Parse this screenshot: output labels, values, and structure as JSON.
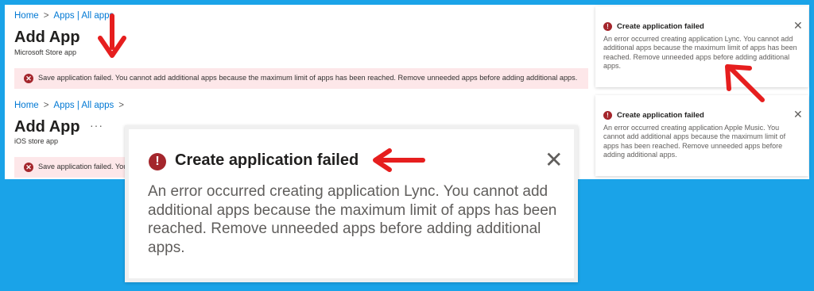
{
  "colors": {
    "background": "#1aa3e8",
    "error_red": "#a4262c",
    "error_bar": "#fde7e9",
    "link_blue": "#0078d4",
    "annotation_arrow": "#e61e1e"
  },
  "top_section": {
    "breadcrumb": {
      "home": "Home",
      "separator": ">",
      "apps": "Apps | All apps"
    },
    "title": "Add App",
    "subtitle": "Microsoft Store app",
    "error_message": "Save application failed. You cannot add additional apps because the maximum limit of apps has been reached. Remove unneeded apps before adding additional apps."
  },
  "bottom_section": {
    "breadcrumb": {
      "home": "Home",
      "separator": ">",
      "apps": "Apps | All apps",
      "trailing_separator": ">"
    },
    "title": "Add App",
    "more": "···",
    "subtitle": "iOS store app",
    "error_message": "Save application failed. You"
  },
  "toast_lync": {
    "icon": "error-icon",
    "title": "Create application failed",
    "body": "An error occurred creating application Lync. You cannot add additional apps because the maximum limit of apps has been reached. Remove unneeded apps before adding additional apps.",
    "close": "✕"
  },
  "toast_apple_music": {
    "icon": "error-icon",
    "title": "Create application failed",
    "body": "An error occurred creating application Apple Music. You cannot add additional apps because the maximum limit of apps has been reached. Remove unneeded apps before adding additional apps.",
    "close": "✕"
  },
  "toast_zoomed": {
    "icon": "error-icon",
    "title": "Create application failed",
    "body": "An error occurred creating application Lync. You cannot add additional apps because the maximum limit of apps has been reached. Remove unneeded apps before adding additional apps.",
    "close": "✕"
  }
}
